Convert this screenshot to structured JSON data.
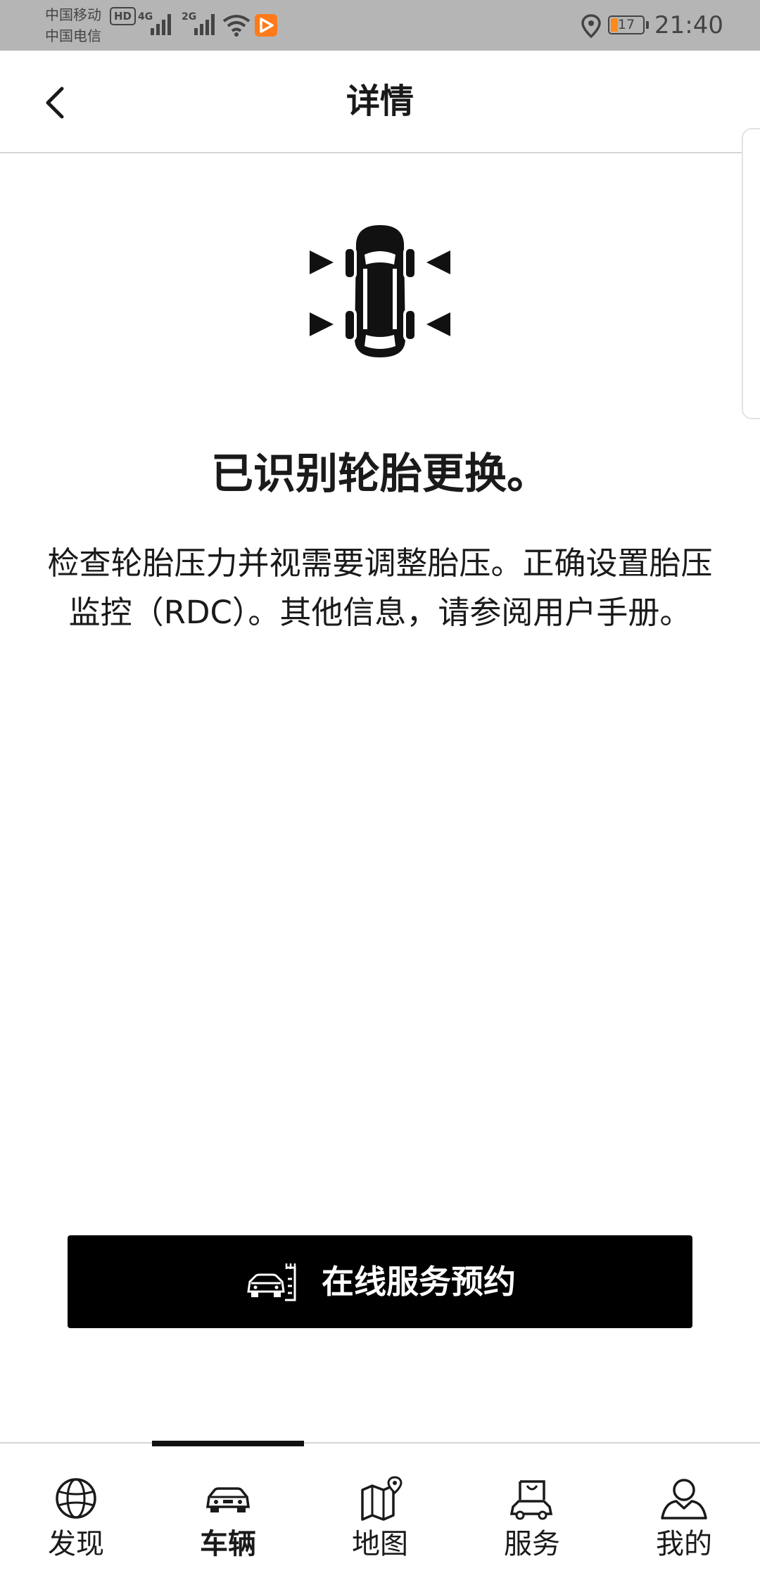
{
  "status_bar": {
    "carrier_1": "中国移动",
    "carrier_2": "中国电信",
    "hd_badge": "HD",
    "network_1": "4G",
    "network_2": "2G",
    "battery_level": "17",
    "time": "21:40",
    "icons": [
      "signal-icon",
      "wifi-icon",
      "app-notify-icon",
      "location-icon",
      "battery-icon"
    ]
  },
  "header": {
    "title": "详情",
    "back_icon": "chevron-left-icon"
  },
  "content": {
    "illustration_icon": "tire-change-car-icon",
    "title": "已识别轮胎更换。",
    "body": "检查轮胎压力并视需要调整胎压。正确设置胎压监控（RDC）。其他信息，请参阅用户手册。"
  },
  "actions": {
    "service_button_label": "在线服务预约",
    "service_button_icon": "service-car-icon"
  },
  "bottom_nav": {
    "active_index": 1,
    "items": [
      {
        "label": "发现",
        "icon": "globe-icon"
      },
      {
        "label": "车辆",
        "icon": "car-icon"
      },
      {
        "label": "地图",
        "icon": "map-icon"
      },
      {
        "label": "服务",
        "icon": "shopping-bag-car-icon"
      },
      {
        "label": "我的",
        "icon": "user-icon"
      }
    ]
  },
  "colors": {
    "status_bar_bg": "#b5b5b5",
    "primary_button_bg": "#000000",
    "text": "#1a1a1a",
    "battery_fill": "#ff8a1a",
    "notify_accent": "#ff7a1a"
  }
}
